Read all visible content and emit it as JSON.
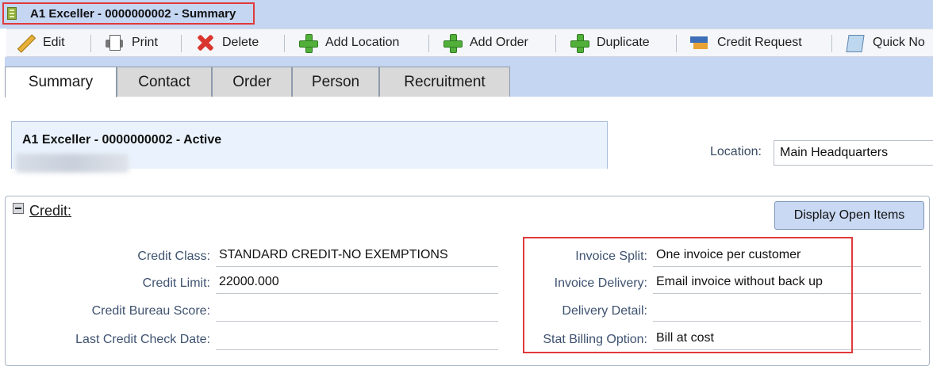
{
  "window": {
    "title": "A1 Exceller - 0000000002 - Summary",
    "icon": "building-icon"
  },
  "toolbar": {
    "edit": "Edit",
    "print": "Print",
    "delete": "Delete",
    "add_location": "Add Location",
    "add_order": "Add Order",
    "duplicate": "Duplicate",
    "credit_request": "Credit Request",
    "quick_note": "Quick No"
  },
  "tabs": [
    {
      "label": "Summary",
      "active": true
    },
    {
      "label": "Contact"
    },
    {
      "label": "Order"
    },
    {
      "label": "Person"
    },
    {
      "label": "Recruitment"
    }
  ],
  "account": {
    "title": "A1 Exceller - 0000000002 - Active",
    "location_label": "Location:",
    "location_value": "Main Headquarters"
  },
  "credit": {
    "section_title": "Credit:",
    "display_open_items": "Display Open Items",
    "left_fields": [
      {
        "label": "Credit Class:",
        "value": "STANDARD CREDIT-NO EXEMPTIONS"
      },
      {
        "label": "Credit Limit:",
        "value": "22000.000"
      },
      {
        "label": "Credit Bureau Score:",
        "value": ""
      },
      {
        "label": "Last Credit Check Date:",
        "value": ""
      }
    ],
    "right_fields": [
      {
        "label": "Invoice Split:",
        "value": "One invoice per customer"
      },
      {
        "label": "Invoice Delivery:",
        "value": "Email invoice without back up"
      },
      {
        "label": "Delivery Detail:",
        "value": ""
      },
      {
        "label": "Stat Billing Option:",
        "value": "Bill at cost"
      }
    ]
  },
  "colors": {
    "accent_blue": "#c5d6f2",
    "highlight_red": "#e03a3a",
    "label_blue": "#3e5270"
  }
}
